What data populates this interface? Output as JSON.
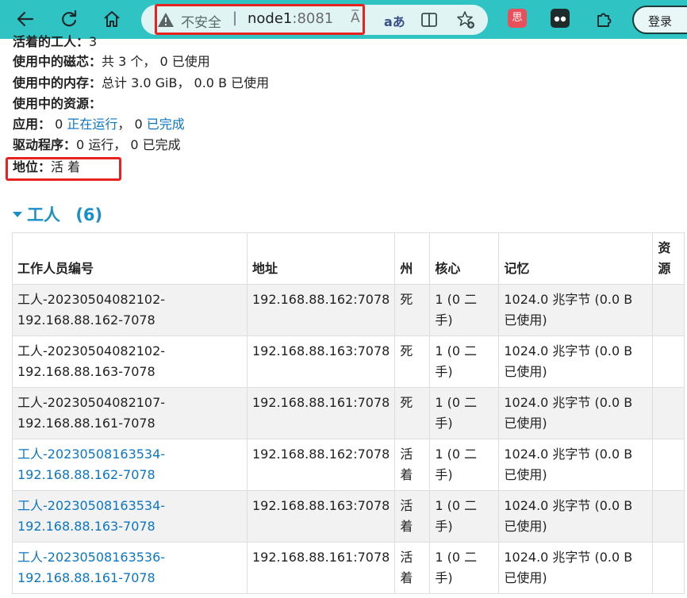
{
  "browser": {
    "security_label": "不安全",
    "separator": "|",
    "host": "node1",
    "port": ":8081",
    "read_aloud": "A̅",
    "translate": "aあ",
    "login_label": "登录",
    "extension_label": "思"
  },
  "summary": {
    "alive_workers_label": "活着的工人：",
    "alive_workers_value": "3",
    "cores_label": "使用中的磁芯：",
    "cores_value": "共 3 个，  0 已使用",
    "memory_label": "使用中的内存：",
    "memory_value": "总计 3.0 GiB，  0.0 B 已使用",
    "resources_label": "使用中的资源：",
    "apps_label": "应用：",
    "apps_running_count": "0",
    "apps_running_link": "正在运行",
    "apps_sep": "，",
    "apps_completed_count": "0",
    "apps_completed_link": "已完成",
    "drivers_label": "驱动程序：",
    "drivers_value": "0 运行，  0 已完成",
    "status_label": "地位：",
    "status_value": "活 着"
  },
  "workers_section": {
    "title": "工人",
    "count": "(6)"
  },
  "workers_table": {
    "headers": {
      "id": "工作人员编号",
      "address": "地址",
      "state": "州",
      "cores": "核心",
      "memory": "记忆",
      "resources": "资源"
    },
    "rows": [
      {
        "id": "工人-20230504082102-192.168.88.162-7078",
        "address": "192.168.88.162:7078",
        "state": "死",
        "cores": "1 (0 二手)",
        "memory": "1024.0 兆字节  (0.0 B 已使用)",
        "resources": "",
        "linked": false
      },
      {
        "id": "工人-20230504082102-192.168.88.163-7078",
        "address": "192.168.88.163:7078",
        "state": "死",
        "cores": "1 (0 二手)",
        "memory": "1024.0 兆字节  (0.0 B 已使用)",
        "resources": "",
        "linked": false
      },
      {
        "id": "工人-20230504082107-192.168.88.161-7078",
        "address": "192.168.88.161:7078",
        "state": "死",
        "cores": "1 (0 二手)",
        "memory": "1024.0 兆字节  (0.0 B 已使用)",
        "resources": "",
        "linked": false
      },
      {
        "id": "工人-20230508163534-192.168.88.162-7078",
        "address": "192.168.88.162:7078",
        "state": "活着",
        "cores": "1 (0 二手)",
        "memory": "1024.0 兆字节  (0.0 B 已使用)",
        "resources": "",
        "linked": true
      },
      {
        "id": "工人-20230508163534-192.168.88.163-7078",
        "address": "192.168.88.163:7078",
        "state": "活着",
        "cores": "1 (0 二手)",
        "memory": "1024.0 兆字节  (0.0 B 已使用)",
        "resources": "",
        "linked": true
      },
      {
        "id": "工人-20230508163536-192.168.88.161-7078",
        "address": "192.168.88.161:7078",
        "state": "活着",
        "cores": "1 (0 二手)",
        "memory": "1024.0 兆字节  (0.0 B 已使用)",
        "resources": "",
        "linked": true
      }
    ]
  },
  "icons": [
    "back-icon",
    "refresh-icon",
    "home-icon",
    "warning-icon",
    "read-aloud-icon",
    "translate-icon",
    "split-screen-icon",
    "add-favorite-icon",
    "extension-icon",
    "puzzle-icon",
    "dropdown-triangle-icon"
  ],
  "colors": {
    "toolbar": "#2fc3c4",
    "link": "#0b76c4",
    "section_title": "#1a8fc7",
    "highlight_box": "#e8231f",
    "row_stripe": "#f2f2f2"
  }
}
